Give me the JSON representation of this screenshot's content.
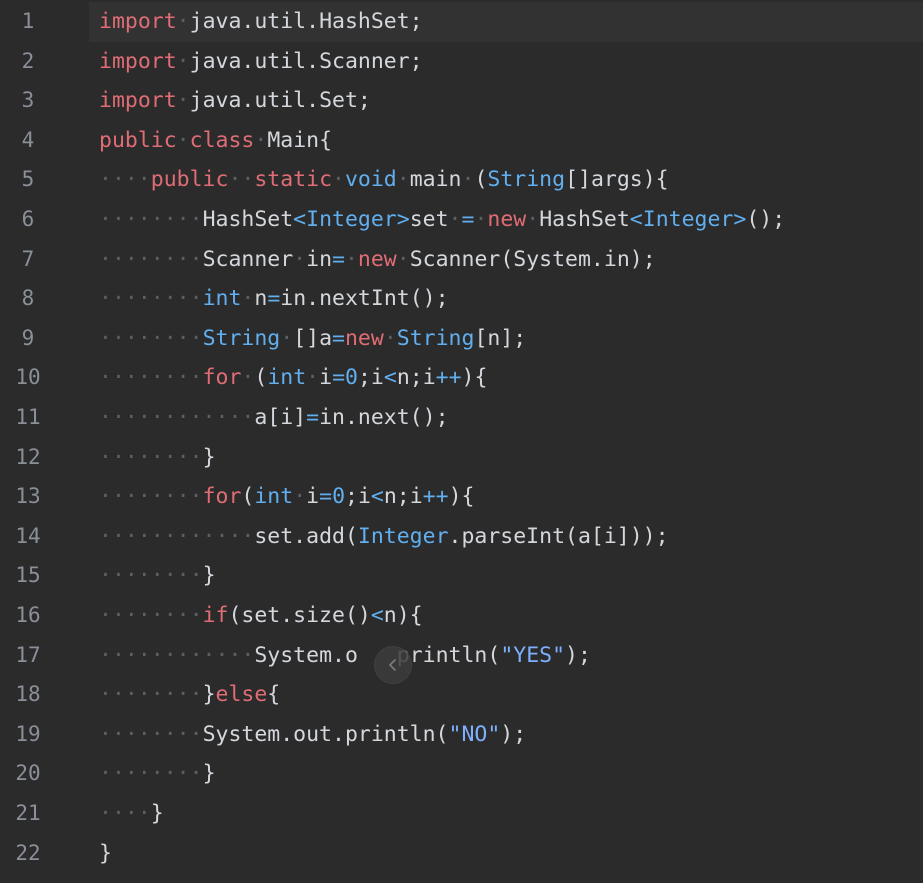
{
  "editor": {
    "line_numbers": [
      "1",
      "2",
      "3",
      "4",
      "5",
      "6",
      "7",
      "8",
      "9",
      "10",
      "11",
      "12",
      "13",
      "14",
      "15",
      "16",
      "17",
      "18",
      "19",
      "20",
      "21",
      "22"
    ],
    "lines": [
      [
        {
          "t": "import",
          "c": "kw"
        },
        {
          "t": "·",
          "c": "ws"
        },
        {
          "t": "java.util.HashSet;",
          "c": "tx"
        }
      ],
      [
        {
          "t": "import",
          "c": "kw"
        },
        {
          "t": "·",
          "c": "ws"
        },
        {
          "t": "java.util.Scanner;",
          "c": "tx"
        }
      ],
      [
        {
          "t": "import",
          "c": "kw"
        },
        {
          "t": "·",
          "c": "ws"
        },
        {
          "t": "java.util.Set;",
          "c": "tx"
        }
      ],
      [
        {
          "t": "public",
          "c": "kw"
        },
        {
          "t": "·",
          "c": "ws"
        },
        {
          "t": "class",
          "c": "kw"
        },
        {
          "t": "·",
          "c": "ws"
        },
        {
          "t": "Main{",
          "c": "tx"
        }
      ],
      [
        {
          "t": "····",
          "c": "ws"
        },
        {
          "t": "public",
          "c": "kw"
        },
        {
          "t": "··",
          "c": "ws"
        },
        {
          "t": "static",
          "c": "kw"
        },
        {
          "t": "·",
          "c": "ws"
        },
        {
          "t": "void",
          "c": "ty"
        },
        {
          "t": "·",
          "c": "ws"
        },
        {
          "t": "main",
          "c": "tx"
        },
        {
          "t": "·",
          "c": "ws"
        },
        {
          "t": "(",
          "c": "tx"
        },
        {
          "t": "String",
          "c": "ty"
        },
        {
          "t": "[]args){",
          "c": "tx"
        }
      ],
      [
        {
          "t": "········",
          "c": "ws"
        },
        {
          "t": "HashSet",
          "c": "tx"
        },
        {
          "t": "<",
          "c": "op"
        },
        {
          "t": "Integer",
          "c": "ty"
        },
        {
          "t": ">",
          "c": "op"
        },
        {
          "t": "set",
          "c": "tx"
        },
        {
          "t": "·",
          "c": "ws"
        },
        {
          "t": "=",
          "c": "op"
        },
        {
          "t": "·",
          "c": "ws"
        },
        {
          "t": "new",
          "c": "kw"
        },
        {
          "t": "·",
          "c": "ws"
        },
        {
          "t": "HashSet",
          "c": "tx"
        },
        {
          "t": "<",
          "c": "op"
        },
        {
          "t": "Integer",
          "c": "ty"
        },
        {
          "t": ">",
          "c": "op"
        },
        {
          "t": "();",
          "c": "tx"
        }
      ],
      [
        {
          "t": "········",
          "c": "ws"
        },
        {
          "t": "Scanner",
          "c": "tx"
        },
        {
          "t": "·",
          "c": "ws"
        },
        {
          "t": "in",
          "c": "tx"
        },
        {
          "t": "=",
          "c": "op"
        },
        {
          "t": "·",
          "c": "ws"
        },
        {
          "t": "new",
          "c": "kw"
        },
        {
          "t": "·",
          "c": "ws"
        },
        {
          "t": "Scanner(System.in);",
          "c": "tx"
        }
      ],
      [
        {
          "t": "········",
          "c": "ws"
        },
        {
          "t": "int",
          "c": "ty"
        },
        {
          "t": "·",
          "c": "ws"
        },
        {
          "t": "n",
          "c": "tx"
        },
        {
          "t": "=",
          "c": "op"
        },
        {
          "t": "in.nextInt();",
          "c": "tx"
        }
      ],
      [
        {
          "t": "········",
          "c": "ws"
        },
        {
          "t": "String",
          "c": "ty"
        },
        {
          "t": "·",
          "c": "ws"
        },
        {
          "t": "[]a",
          "c": "tx"
        },
        {
          "t": "=",
          "c": "op"
        },
        {
          "t": "new",
          "c": "kw"
        },
        {
          "t": "·",
          "c": "ws"
        },
        {
          "t": "String",
          "c": "ty"
        },
        {
          "t": "[n];",
          "c": "tx"
        }
      ],
      [
        {
          "t": "········",
          "c": "ws"
        },
        {
          "t": "for",
          "c": "kw"
        },
        {
          "t": "·",
          "c": "ws"
        },
        {
          "t": "(",
          "c": "tx"
        },
        {
          "t": "int",
          "c": "ty"
        },
        {
          "t": "·",
          "c": "ws"
        },
        {
          "t": "i",
          "c": "tx"
        },
        {
          "t": "=",
          "c": "op"
        },
        {
          "t": "0",
          "c": "nm"
        },
        {
          "t": ";i",
          "c": "tx"
        },
        {
          "t": "<",
          "c": "op"
        },
        {
          "t": "n;i",
          "c": "tx"
        },
        {
          "t": "++",
          "c": "op"
        },
        {
          "t": "){",
          "c": "tx"
        }
      ],
      [
        {
          "t": "············",
          "c": "ws"
        },
        {
          "t": "a[i]",
          "c": "tx"
        },
        {
          "t": "=",
          "c": "op"
        },
        {
          "t": "in.next();",
          "c": "tx"
        }
      ],
      [
        {
          "t": "········",
          "c": "ws"
        },
        {
          "t": "}",
          "c": "tx"
        }
      ],
      [
        {
          "t": "········",
          "c": "ws"
        },
        {
          "t": "for",
          "c": "kw"
        },
        {
          "t": "(",
          "c": "tx"
        },
        {
          "t": "int",
          "c": "ty"
        },
        {
          "t": "·",
          "c": "ws"
        },
        {
          "t": "i",
          "c": "tx"
        },
        {
          "t": "=",
          "c": "op"
        },
        {
          "t": "0",
          "c": "nm"
        },
        {
          "t": ";i",
          "c": "tx"
        },
        {
          "t": "<",
          "c": "op"
        },
        {
          "t": "n;i",
          "c": "tx"
        },
        {
          "t": "++",
          "c": "op"
        },
        {
          "t": "){",
          "c": "tx"
        }
      ],
      [
        {
          "t": "············",
          "c": "ws"
        },
        {
          "t": "set.add(",
          "c": "tx"
        },
        {
          "t": "Integer",
          "c": "ty"
        },
        {
          "t": ".parseInt(a[i]));",
          "c": "tx"
        }
      ],
      [
        {
          "t": "········",
          "c": "ws"
        },
        {
          "t": "}",
          "c": "tx"
        }
      ],
      [
        {
          "t": "········",
          "c": "ws"
        },
        {
          "t": "if",
          "c": "kw"
        },
        {
          "t": "(set.size()",
          "c": "tx"
        },
        {
          "t": "<",
          "c": "op"
        },
        {
          "t": "n){",
          "c": "tx"
        }
      ],
      [
        {
          "t": "············",
          "c": "ws"
        },
        {
          "t": "System.o",
          "c": "tx"
        },
        {
          "t": "   ",
          "c": "tx"
        },
        {
          "t": "println(",
          "c": "tx"
        },
        {
          "t": "\"YES\"",
          "c": "st"
        },
        {
          "t": ");",
          "c": "tx"
        }
      ],
      [
        {
          "t": "········",
          "c": "ws"
        },
        {
          "t": "}",
          "c": "tx"
        },
        {
          "t": "else",
          "c": "kw"
        },
        {
          "t": "{",
          "c": "tx"
        }
      ],
      [
        {
          "t": "········",
          "c": "ws"
        },
        {
          "t": "System.out.println(",
          "c": "tx"
        },
        {
          "t": "\"NO\"",
          "c": "st"
        },
        {
          "t": ");",
          "c": "tx"
        }
      ],
      [
        {
          "t": "········",
          "c": "ws"
        },
        {
          "t": "}",
          "c": "tx"
        }
      ],
      [
        {
          "t": "····",
          "c": "ws"
        },
        {
          "t": "}",
          "c": "tx"
        }
      ],
      [
        {
          "t": "}",
          "c": "tx"
        }
      ]
    ],
    "current_line_index": 0
  },
  "overlay": {
    "icon": "chevron-left-icon"
  },
  "colors": {
    "background": "#2b2b2b",
    "keyword": "#e06c75",
    "type": "#61afef",
    "string": "#7fb0ff",
    "text": "#d4d7dc",
    "line_number": "#8a8f98",
    "whitespace_dot": "#5b5e63"
  }
}
